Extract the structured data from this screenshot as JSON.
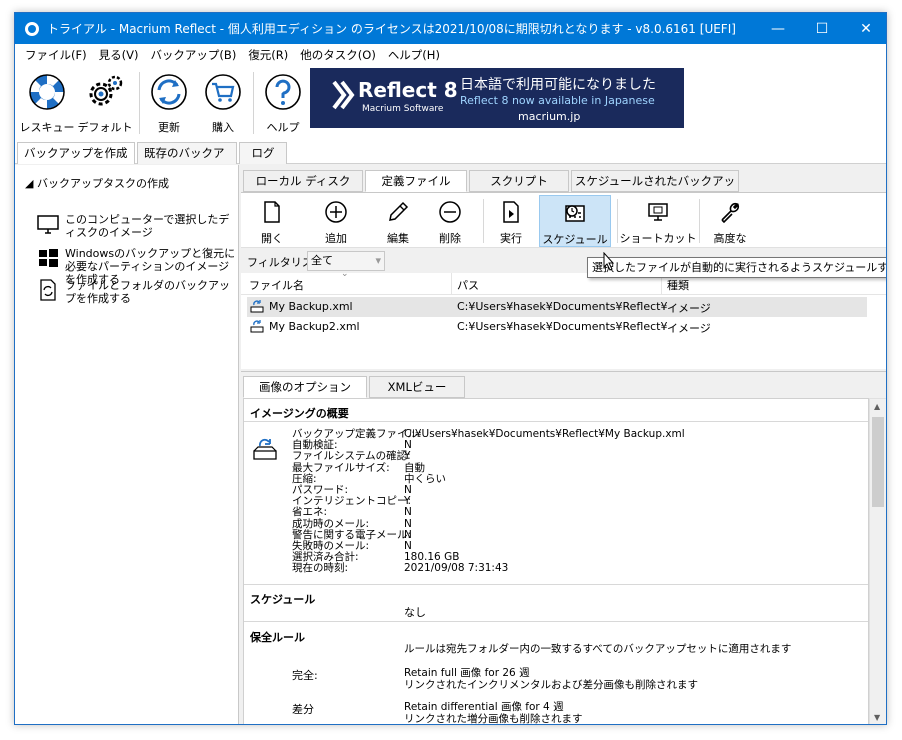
{
  "window": {
    "title": "トライアル - Macrium Reflect - 個人利用エディション のライセンスは2021/10/08に期限切れとなります - v8.0.6161  [UEFI]",
    "minimize": "—",
    "maximize": "☐",
    "close": "✕"
  },
  "menu": [
    "ファイル(F)",
    "見る(V)",
    "バックアップ(B)",
    "復元(R)",
    "他のタスク(O)",
    "ヘルプ(H)"
  ],
  "toolbar": {
    "rescue": "レスキュー",
    "default": "デフォルト",
    "update": "更新",
    "buy": "購入",
    "help": "ヘルプ"
  },
  "banner": {
    "product": "Reflect 8",
    "vendor": "Macrium Software",
    "jp": "日本語で利用可能になりました",
    "en": "Reflect 8 now available in Japanese",
    "url": "macrium.jp",
    "bg": "#1a2a5c"
  },
  "main_tabs": [
    "バックアップを作成する",
    "既存のバックアップ",
    "ログ"
  ],
  "left": {
    "header": "バックアップタスクの作成",
    "items": [
      "このコンピューターで選択したディスクのイメージ",
      "Windowsのバックアップと復元に必要なパーティションのイメージを作成する",
      "ファイルとフォルダのバックアップを作成する"
    ]
  },
  "sub_tabs": [
    "ローカル ディスク",
    "定義ファイル",
    "スクリプト",
    "スケジュールされたバックアップ"
  ],
  "def_toolbar": {
    "open": "開く",
    "add": "追加",
    "edit": "編集",
    "delete": "削除",
    "run": "実行",
    "schedule": "スケジュール",
    "shortcut": "ショートカット",
    "advanced": "高度な"
  },
  "filter": {
    "label": "フィルタリスト",
    "value": "全て"
  },
  "file_list": {
    "headers": [
      "ファイル名",
      "パス",
      "種類"
    ],
    "rows": [
      {
        "name": "My Backup.xml",
        "path": "C:¥Users¥hasek¥Documents¥Reflect¥",
        "type": "イメージ"
      },
      {
        "name": "My Backup2.xml",
        "path": "C:¥Users¥hasek¥Documents¥Reflect¥",
        "type": "イメージ"
      }
    ]
  },
  "tooltip": "選択したファイルが自動的に実行されるようスケジュールする",
  "detail_tabs": [
    "画像のオプション",
    "XMLビュー"
  ],
  "details": {
    "imaging_title": "イメージングの概要",
    "imaging": [
      {
        "k": "バックアップ定義ファイル:",
        "v": "C:¥Users¥hasek¥Documents¥Reflect¥My Backup.xml"
      },
      {
        "k": "自動検証:",
        "v": "N"
      },
      {
        "k": "ファイルシステムの確認:",
        "v": "Y"
      },
      {
        "k": "最大ファイルサイズ:",
        "v": "自動"
      },
      {
        "k": "圧縮:",
        "v": "中くらい"
      },
      {
        "k": "パスワード:",
        "v": "N"
      },
      {
        "k": "インテリジェントコピー:",
        "v": "Y"
      },
      {
        "k": "省エネ:",
        "v": "N"
      },
      {
        "k": "成功時のメール:",
        "v": "N"
      },
      {
        "k": "警告に関する電子メール:",
        "v": "N"
      },
      {
        "k": "失敗時のメール:",
        "v": "N"
      },
      {
        "k": "選択済み合計:",
        "v": "180.16 GB"
      },
      {
        "k": "現在の時刻:",
        "v": "2021/09/08 7:31:43"
      }
    ],
    "schedule_title": "スケジュール",
    "schedule_value": "なし",
    "retention_title": "保全ルール",
    "retention_note": "ルールは宛先フォルダー内の一致するすべてのバックアップセットに適用されます",
    "full_key": "完全:",
    "full_line1": "Retain full 画像 for 26 週",
    "full_line2": "リンクされたインクリメンタルおよび差分画像も削除されます",
    "diff_key": "差分",
    "diff_line1": "Retain differential 画像 for 4 週",
    "diff_line2": "リンクされた増分画像も削除されます"
  }
}
